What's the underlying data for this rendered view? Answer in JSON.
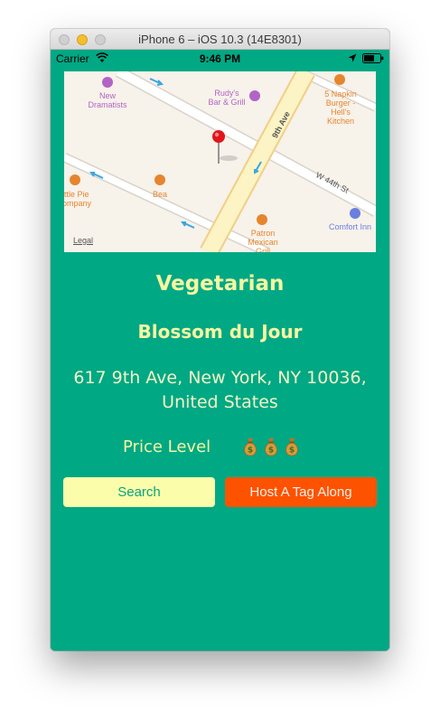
{
  "window": {
    "title": "iPhone 6 – iOS 10.3 (14E8301)"
  },
  "statusbar": {
    "carrier": "Carrier",
    "time": "9:46 PM"
  },
  "map": {
    "legal": "Legal",
    "streets": {
      "avenue": "9th Ave",
      "street": "W 44th St"
    },
    "pois": [
      {
        "name": "New\nDramatists",
        "icon": "theater-icon"
      },
      {
        "name": "Rudy's\nBar & Grill",
        "icon": "bar-icon"
      },
      {
        "name": "5 Napkin\nBurger -\nHell's\nKitchen",
        "icon": "restaurant-icon"
      },
      {
        "name": "ittle Pie\nompany",
        "icon": "bakery-icon"
      },
      {
        "name": "Bea",
        "icon": "restaurant-icon"
      },
      {
        "name": "Patron\nMexican\nGrill",
        "icon": "restaurant-icon"
      },
      {
        "name": "Comfort Inn",
        "icon": "hotel-icon"
      }
    ]
  },
  "restaurant": {
    "category": "Vegetarian",
    "name": "Blossom du Jour",
    "address": "617 9th Ave, New York, NY 10036, United States",
    "price_label": "Price Level",
    "price_level": 3
  },
  "actions": {
    "search_label": "Search",
    "host_label": "Host A Tag Along"
  },
  "colors": {
    "background": "#00a884",
    "accent_yellow": "#fbfdab",
    "accent_orange": "#fd5200"
  }
}
